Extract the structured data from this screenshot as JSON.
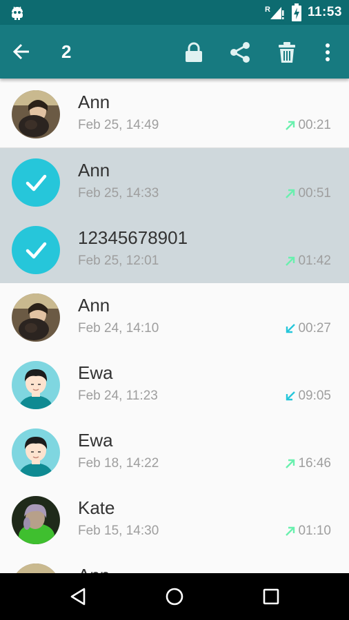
{
  "status_bar": {
    "time": "11:53",
    "network_label": "R",
    "icons": [
      "android-icon",
      "signal-icon",
      "battery-charging-icon"
    ]
  },
  "app_bar": {
    "selected_count": "2",
    "actions": [
      "back-arrow-icon",
      "lock-icon",
      "share-icon",
      "trash-icon",
      "more-vert-icon"
    ],
    "colors": {
      "app_bar": "#177a80",
      "status_bar": "#0d6b70"
    }
  },
  "calls": [
    {
      "name": "Ann",
      "date": "Feb 25, 14:49",
      "duration": "00:21",
      "direction": "outgoing",
      "selected": false,
      "avatar": "photo-ann"
    },
    {
      "name": "Ann",
      "date": "Feb 25, 14:33",
      "duration": "00:51",
      "direction": "outgoing",
      "selected": true,
      "avatar": "check"
    },
    {
      "name": "12345678901",
      "date": "Feb 25, 12:01",
      "duration": "01:42",
      "direction": "outgoing",
      "selected": true,
      "avatar": "check"
    },
    {
      "name": "Ann",
      "date": "Feb 24, 14:10",
      "duration": "00:27",
      "direction": "incoming",
      "selected": false,
      "avatar": "photo-ann"
    },
    {
      "name": "Ewa",
      "date": "Feb 24, 11:23",
      "duration": "09:05",
      "direction": "incoming",
      "selected": false,
      "avatar": "cartoon-ewa"
    },
    {
      "name": "Ewa",
      "date": "Feb 18, 14:22",
      "duration": "16:46",
      "direction": "outgoing",
      "selected": false,
      "avatar": "cartoon-ewa"
    },
    {
      "name": "Kate",
      "date": "Feb 15, 14:30",
      "duration": "01:10",
      "direction": "outgoing",
      "selected": false,
      "avatar": "photo-kate"
    },
    {
      "name": "Ann",
      "date": "",
      "duration": "",
      "direction": "",
      "selected": false,
      "avatar": "photo-ann"
    }
  ],
  "direction_colors": {
    "outgoing": "#69f0ae",
    "incoming": "#26c6da",
    "selection": "#cfd8dc"
  },
  "nav_bar": {
    "buttons": [
      "back-triangle-icon",
      "home-circle-icon",
      "recents-square-icon"
    ]
  }
}
